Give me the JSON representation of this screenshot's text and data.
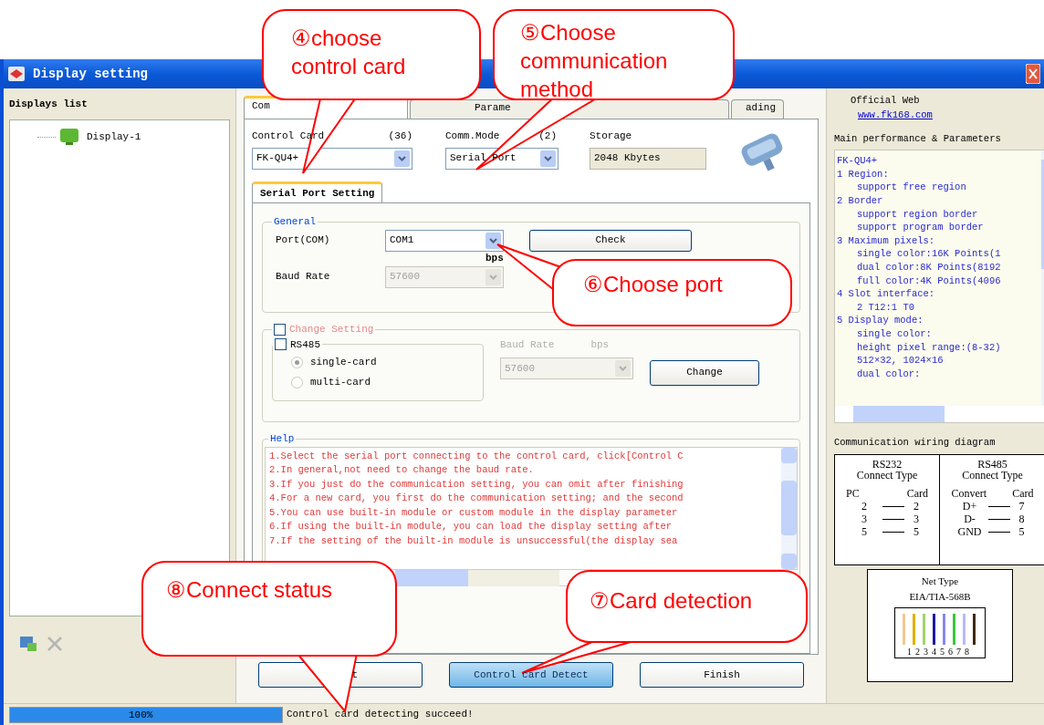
{
  "window": {
    "title": "Display setting"
  },
  "displays_list": {
    "title": "Displays list",
    "items": [
      {
        "label": "Display-1",
        "selected": false
      }
    ]
  },
  "tabs": [
    {
      "label": "Com",
      "selected": true
    },
    {
      "label": "Parame",
      "selected": false
    },
    {
      "label": "ading",
      "selected": false
    }
  ],
  "control_card": {
    "label": "Control Card",
    "count": "(36)",
    "value": "FK-QU4+"
  },
  "comm_mode": {
    "label": "Comm.Mode",
    "count": "(2)",
    "value": "Serial Port"
  },
  "storage": {
    "label": "Storage",
    "value": "2048 Kbytes"
  },
  "sub_tabs": [
    {
      "label": "Serial Port Setting",
      "selected": true
    }
  ],
  "general": {
    "title": "General",
    "port_label": "Port(COM)",
    "port_value": "COM1",
    "unit": "bps",
    "baud_label": "Baud Rate",
    "baud_value": "57600",
    "baud_disabled": true,
    "check_button": "Check"
  },
  "change_setting": {
    "label": "Change Setting",
    "checked": false,
    "rs485_label": "RS485",
    "rs485_checked": false,
    "modes": [
      {
        "label": "single-card",
        "selected": true
      },
      {
        "label": "multi-card",
        "selected": false
      }
    ],
    "baud_label": "Baud Rate",
    "unit": "bps",
    "baud_value": "57600",
    "disabled": true,
    "button": "Change"
  },
  "help": {
    "title": "Help",
    "lines": [
      "1.Select the serial port connecting to the control card, click[Control C",
      "2.In general,not need to change the baud rate.",
      "3.If you just do the communication setting, you can omit after finishing",
      "4.For a new card, you first do the communication setting; and the second",
      "5.You can use built-in module or custom module in the display parameter",
      "6.If using the built-in module, you can load the display setting after",
      "7.If the setting of the built-in module is unsuccessful(the display sea"
    ]
  },
  "buttons": [
    {
      "label": "t",
      "kind": "normal"
    },
    {
      "label": "Control card Detect",
      "kind": "default"
    },
    {
      "label": "Finish",
      "kind": "normal"
    }
  ],
  "official_web": {
    "label": "Official Web",
    "link": "www.fk168.com"
  },
  "parameters": {
    "title": "Main performance & Parameters",
    "items": [
      {
        "text": "FK-QU4+"
      },
      {
        "text": "1 Region:",
        "children": [
          {
            "text": "support free region"
          }
        ]
      },
      {
        "text": "2 Border",
        "children": [
          {
            "text": "support region border"
          },
          {
            "text": "support program border"
          }
        ]
      },
      {
        "text": "3 Maximum pixels:",
        "children": [
          {
            "text": "single color:16K Points(1"
          },
          {
            "text": "dual color:8K Points(8192"
          },
          {
            "text": "full color:4K Points(4096"
          }
        ]
      },
      {
        "text": "4 Slot interface:",
        "children": [
          {
            "text": "2 T12:1 T0"
          }
        ]
      },
      {
        "text": "5 Display mode:",
        "children": [
          {
            "text": "single color:"
          },
          {
            "text": "height pixel range:(8-32)"
          },
          {
            "text": "512×32, 1024×16"
          },
          {
            "text": "dual color:"
          }
        ]
      }
    ]
  },
  "wiring": {
    "title": "Communication wiring diagram",
    "tables": [
      {
        "title": "RS232",
        "subtitle": "Connect Type",
        "head": [
          "PC",
          "Card"
        ],
        "rows": [
          [
            "2",
            "2"
          ],
          [
            "3",
            "3"
          ],
          [
            "5",
            "5"
          ]
        ]
      },
      {
        "title": "RS485",
        "subtitle": "Connect Type",
        "head": [
          "Convert",
          "Card"
        ],
        "rows": [
          [
            "D+",
            "7"
          ],
          [
            "D-",
            "8"
          ],
          [
            "GND",
            "5"
          ]
        ]
      }
    ],
    "net": {
      "title": "Net Type",
      "standard": "EIA/TIA-568B",
      "pins": "12345678"
    }
  },
  "status_bar": {
    "progress": {
      "level": 1,
      "label": "100%"
    },
    "message": "Control card detecting succeed!"
  },
  "callouts": [
    {
      "text": "④choose control card"
    },
    {
      "text": "⑤Choose communication method"
    },
    {
      "text": "⑥Choose port"
    },
    {
      "text": "⑦Card detection"
    },
    {
      "text": "⑧Connect status"
    }
  ]
}
